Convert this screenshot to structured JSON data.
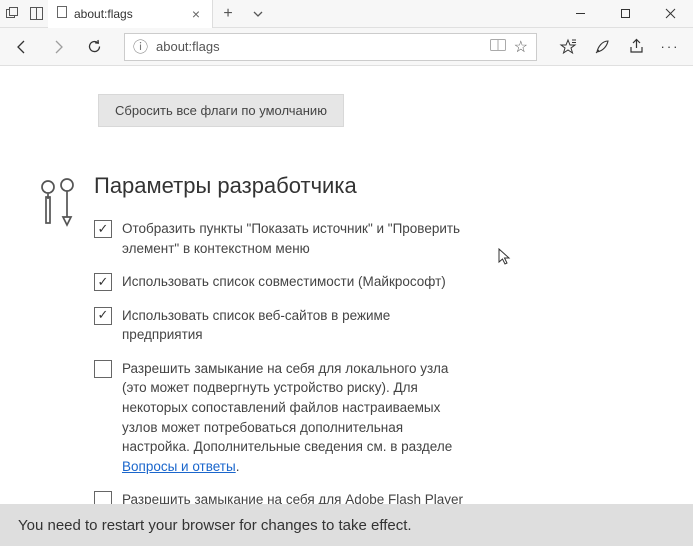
{
  "tab": {
    "title": "about:flags"
  },
  "address": {
    "url": "about:flags"
  },
  "reset_button": "Сбросить все флаги по умолчанию",
  "section": {
    "title": "Параметры разработчика",
    "options": [
      {
        "checked": true,
        "text": "Отобразить пункты \"Показать источник\" и \"Проверить элемент\" в контекстном меню"
      },
      {
        "checked": true,
        "text": "Использовать список совместимости (Майкрософт)"
      },
      {
        "checked": true,
        "text": "Использовать список веб-сайтов в режиме предприятия"
      },
      {
        "checked": false,
        "text": "Разрешить замыкание на себя для локального узла (это может подвергнуть устройство риску). Для некоторых сопоставлений файлов настраиваемых узлов может потребоваться дополнительная настройка. Дополнительные сведения см. в разделе ",
        "link": "Вопросы и ответы",
        "tail": "."
      },
      {
        "checked": false,
        "text": "Разрешить замыкание на себя для Adobe Flash Player localhost (это может подвергнуть устройство риску)"
      }
    ]
  },
  "restart_message": "You need to restart your browser for changes to take effect."
}
